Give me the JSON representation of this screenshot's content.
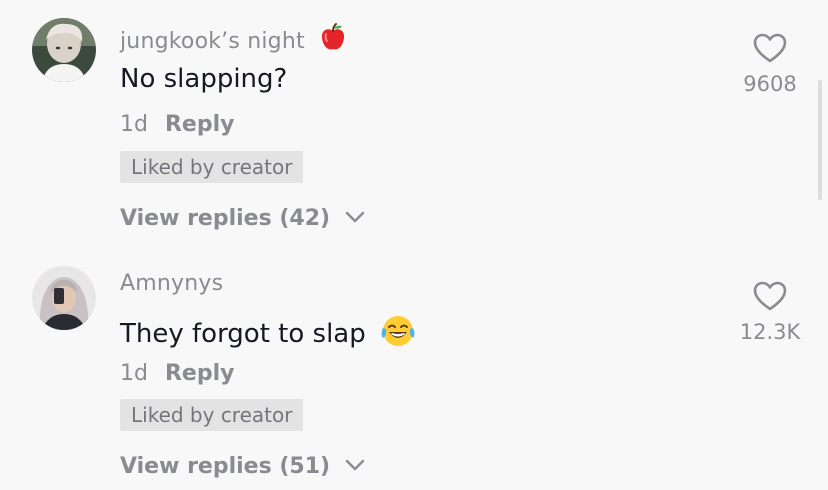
{
  "comments": [
    {
      "username": "jungkook’s night",
      "username_emoji": "apple-icon",
      "text": "No slapping?",
      "age": "1d",
      "reply_label": "Reply",
      "liked_badge": "Liked by creator",
      "view_replies": "View replies (42)",
      "like_count": "9608"
    },
    {
      "username": "Amnynys",
      "text": "They forgot to slap",
      "text_emoji": "face-with-tears-of-joy-icon",
      "age": "1d",
      "reply_label": "Reply",
      "liked_badge": "Liked by creator",
      "view_replies": "View replies (51)",
      "like_count": "12.3K"
    }
  ],
  "colors": {
    "background": "#f8f8f8",
    "username": "#8a8b91",
    "text": "#161823",
    "badge_bg": "#e3e3e4"
  }
}
